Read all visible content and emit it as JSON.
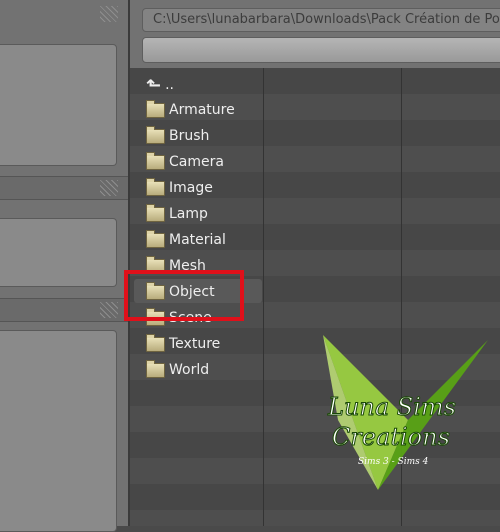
{
  "file_browser": {
    "path": "C:\\Users\\lunabarbara\\Downloads\\Pack Création de Pose",
    "filename": "",
    "parent_label": "..",
    "items": [
      {
        "label": "Armature"
      },
      {
        "label": "Brush"
      },
      {
        "label": "Camera"
      },
      {
        "label": "Image"
      },
      {
        "label": "Lamp"
      },
      {
        "label": "Material"
      },
      {
        "label": "Mesh"
      },
      {
        "label": "Object"
      },
      {
        "label": "Scene"
      },
      {
        "label": "Texture"
      },
      {
        "label": "World"
      }
    ],
    "highlighted": "Object"
  },
  "annotation": {
    "color": "#e0101a"
  },
  "watermark": {
    "line1": "Luna Sims",
    "line2": "Creations",
    "line3": "Sims 3 - Sims 4"
  },
  "colors": {
    "logo_green": "#7ac51a"
  }
}
